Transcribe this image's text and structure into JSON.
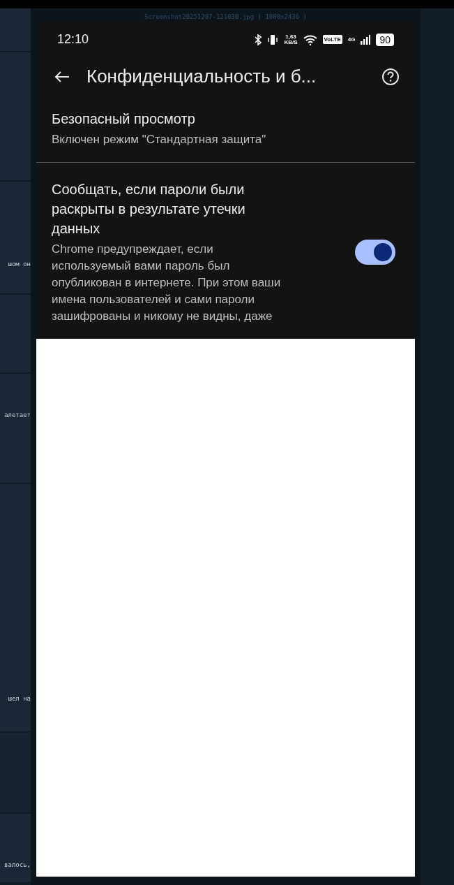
{
  "viewer": {
    "caption": "Screenshot20251207-121030.jpg ( 1080x2436 )",
    "background_posts": [
      "шом он",
      "алетает",
      "шел на",
      "валось,"
    ],
    "phone": {
      "status_bar": {
        "time": "12:10",
        "speed_value": "1,63",
        "speed_unit": "KB/S",
        "volte": "VoLTE",
        "network": "4G",
        "battery": "90"
      },
      "toolbar": {
        "title": "Конфиденциальность и б..."
      },
      "settings": [
        {
          "kind": "link",
          "title": "Безопасный просмотр",
          "subtitle": "Включен режим \"Стандартная защита\""
        },
        {
          "kind": "toggle",
          "title": "Сообщать, если пароли были раскрыты в результате утечки данных",
          "description": "Chrome предупреждает, если используемый вами пароль был опубликован в интернете. При этом ваши имена пользователей и сами пароли зашифрованы и никому не видны, даже",
          "on": true
        }
      ]
    }
  }
}
